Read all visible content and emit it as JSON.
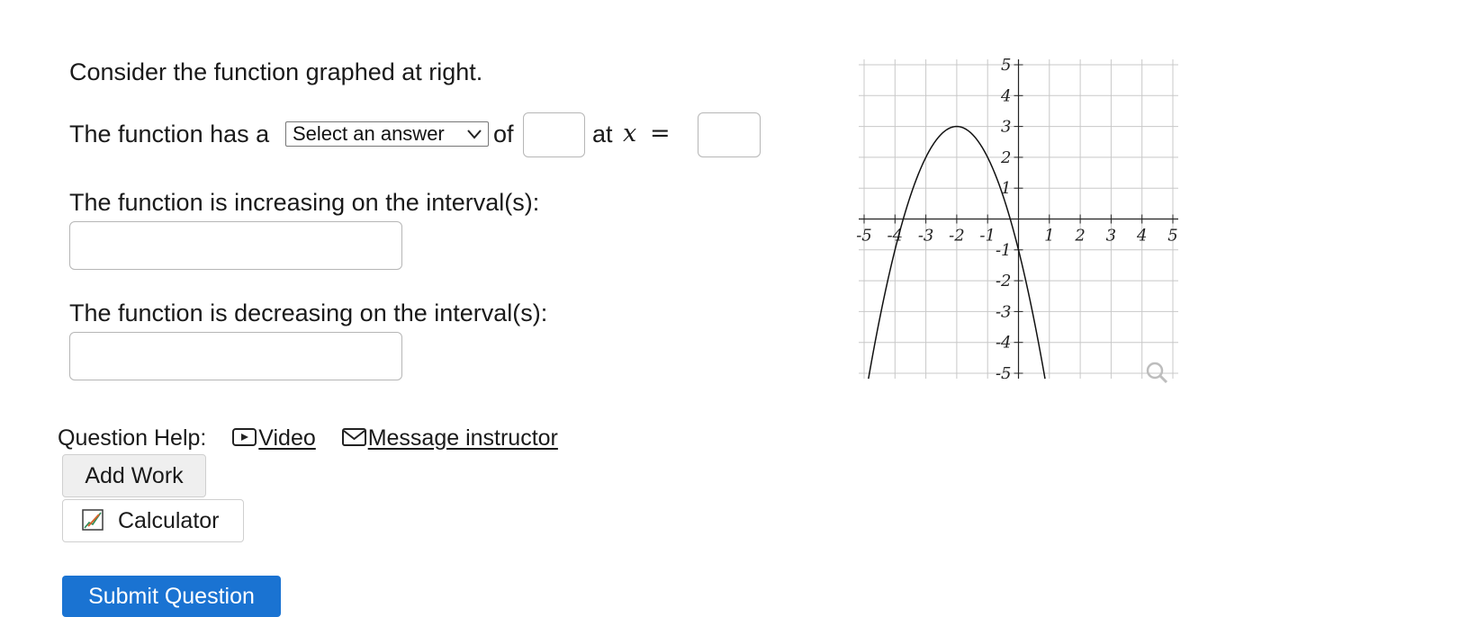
{
  "question": {
    "intro": "Consider the function graphed at right.",
    "line1_prefix": "The function has a",
    "select_value": "Select an answer",
    "line1_of": "of",
    "line1_at": "at",
    "line1_var": "x",
    "line1_eq": "=",
    "increasing_label": "The function is increasing on the interval(s):",
    "decreasing_label": "The function is decreasing on the interval(s):"
  },
  "help": {
    "label": "Question Help:",
    "video": "Video",
    "message": "Message instructor"
  },
  "buttons": {
    "add_work": "Add Work",
    "calculator": "Calculator",
    "submit": "Submit Question"
  },
  "graph": {
    "x_tick_labels": [
      "-5",
      "-4",
      "-3",
      "-2",
      "-1",
      "1",
      "2",
      "3",
      "4",
      "5"
    ],
    "y_tick_labels": [
      "5",
      "4",
      "3",
      "2",
      "1",
      "-1",
      "-2",
      "-3",
      "-4",
      "-5"
    ],
    "function": "y = -(x+2)^2 + 3",
    "vertex": [
      -2,
      3
    ],
    "x_range": [
      -5,
      5
    ],
    "y_range": [
      -5,
      5
    ]
  },
  "colors": {
    "primary_button": "#1a73d2",
    "grid": "#c8c8c8"
  },
  "icons": {
    "video": "video-play-icon",
    "message": "envelope-icon",
    "calculator": "calculator-pencil-icon",
    "zoom": "magnifier-icon",
    "select_chevron": "chevron-down-icon"
  }
}
